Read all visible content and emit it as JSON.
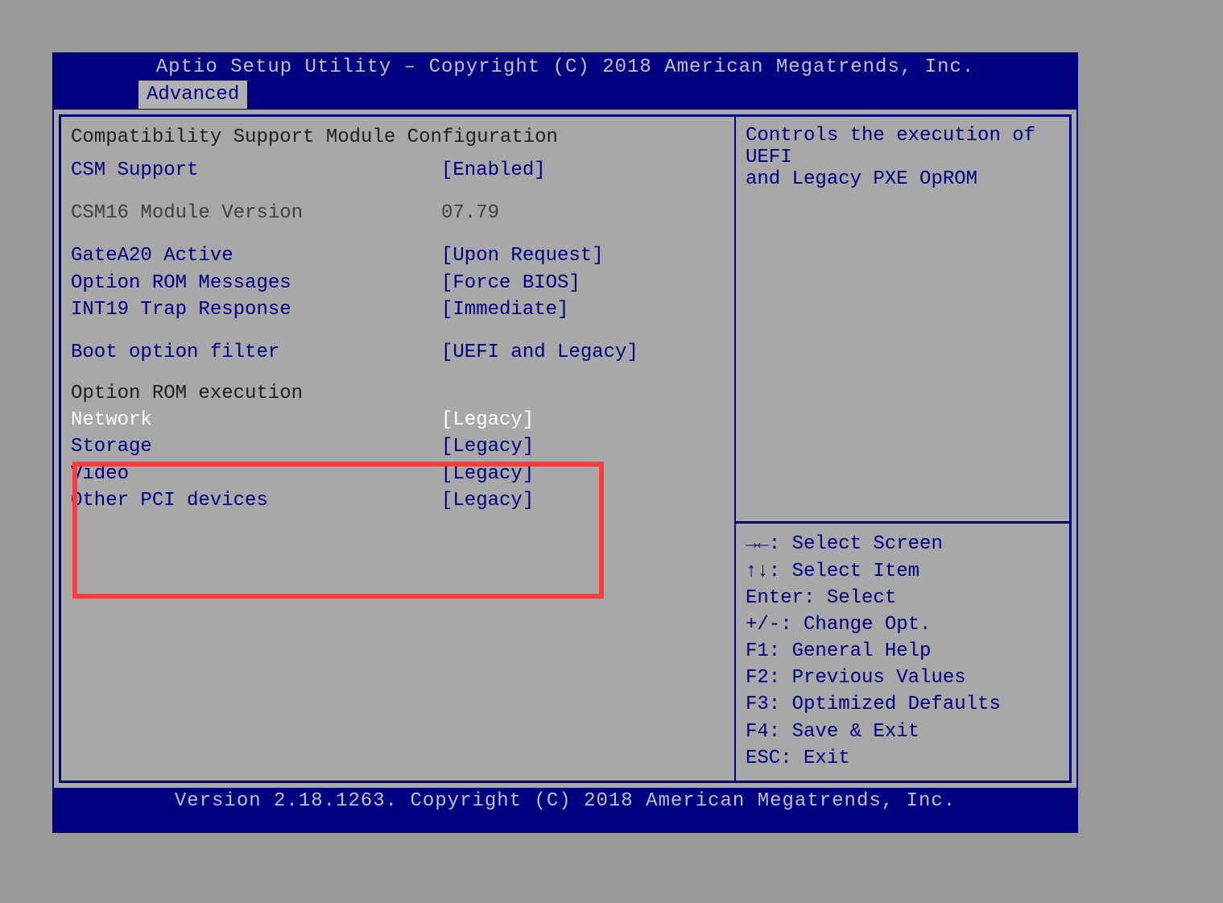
{
  "title": "Aptio Setup Utility – Copyright (C) 2018 American Megatrends, Inc.",
  "tab": "Advanced",
  "section_title": "Compatibility Support Module Configuration",
  "settings": {
    "csm_support": {
      "label": "CSM Support",
      "value": "[Enabled]"
    },
    "csm16_version": {
      "label": "CSM16 Module Version",
      "value": "07.79"
    },
    "gatea20": {
      "label": "GateA20 Active",
      "value": "[Upon Request]"
    },
    "oprom_msgs": {
      "label": "Option ROM Messages",
      "value": "[Force BIOS]"
    },
    "int19": {
      "label": "INT19 Trap Response",
      "value": "[Immediate]"
    },
    "boot_filter": {
      "label": "Boot option filter",
      "value": "[UEFI and Legacy]"
    }
  },
  "oprom_exec_title": "Option ROM execution",
  "oprom_exec": {
    "network": {
      "label": "Network",
      "value": "[Legacy]"
    },
    "storage": {
      "label": "Storage",
      "value": "[Legacy]"
    },
    "video": {
      "label": "Video",
      "value": "[Legacy]"
    },
    "other": {
      "label": "Other PCI devices",
      "value": "[Legacy]"
    }
  },
  "help_text_1": "Controls the execution of UEFI",
  "help_text_2": "and Legacy PXE OpROM",
  "nav": {
    "screen": "→←: Select Screen",
    "item": "↑↓: Select Item",
    "enter": "Enter: Select",
    "change": "+/-: Change Opt.",
    "f1": "F1: General Help",
    "f2": "F2: Previous Values",
    "f3": "F3: Optimized Defaults",
    "f4": "F4: Save & Exit",
    "esc": "ESC: Exit"
  },
  "footer": "Version 2.18.1263. Copyright (C) 2018 American Megatrends, Inc."
}
